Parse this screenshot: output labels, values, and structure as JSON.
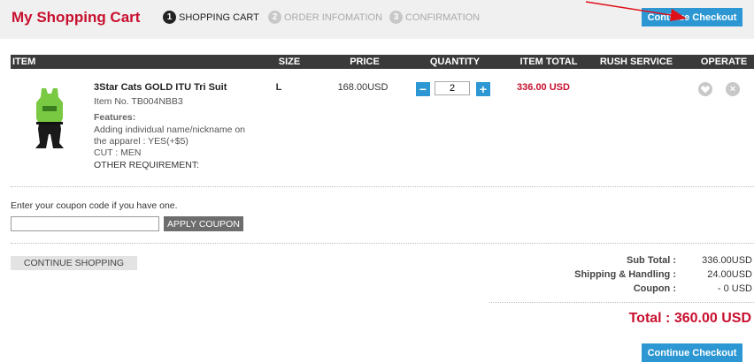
{
  "header": {
    "title": "My Shopping Cart",
    "steps": [
      {
        "num": "1",
        "label": "SHOPPING CART"
      },
      {
        "num": "2",
        "label": "ORDER INFOMATION"
      },
      {
        "num": "3",
        "label": "CONFIRMATION"
      }
    ],
    "checkout_label": "Continue Checkout"
  },
  "table": {
    "headers": [
      "ITEM",
      "SIZE",
      "PRICE",
      "QUANTITY",
      "ITEM TOTAL",
      "RUSH SERVICE",
      "OPERATE"
    ]
  },
  "item": {
    "name": "3Star Cats GOLD ITU Tri Suit",
    "item_no": "Item No. TB004NBB3",
    "features_label": "Features:",
    "feature_lines": [
      "Adding individual name/nickname on",
      "the apparel : YES(+$5)",
      "CUT : MEN",
      "OTHER REQUIREMENT:"
    ],
    "size": "L",
    "price": "168.00USD",
    "quantity": "2",
    "minus": "−",
    "plus": "+",
    "item_total": "336.00 USD",
    "rush_service": "",
    "remove_glyph": "×"
  },
  "coupon": {
    "prompt": "Enter your coupon code if you have one.",
    "value": "",
    "button": "APPLY COUPON"
  },
  "continue_shopping": "CONTINUE SHOPPING",
  "summary": {
    "subtotal_label": "Sub Total :",
    "subtotal_value": "336.00USD",
    "shipping_label": "Shipping & Handling :",
    "shipping_value": "24.00USD",
    "coupon_label": "Coupon :",
    "coupon_value": "- 0 USD",
    "total": "Total : 360.00 USD"
  },
  "colors": {
    "brand_red": "#c8102e",
    "accent_blue": "#2c97d3",
    "header_dark": "#3a3a3a"
  },
  "icons": [
    "heart-icon",
    "close-icon",
    "arrow-pointer"
  ]
}
